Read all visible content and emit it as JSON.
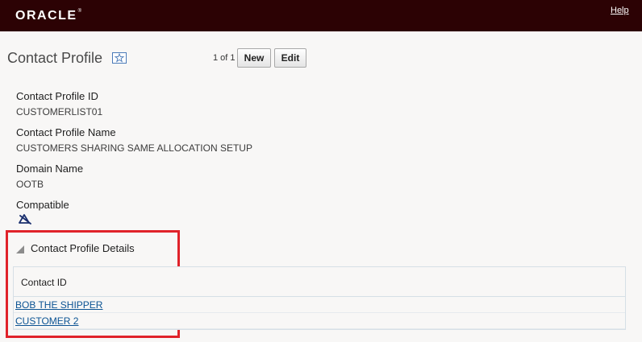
{
  "header": {
    "logo_text": "ORACLE",
    "logo_mark": "®",
    "help_link": "Help",
    "background_color": "#2c0204"
  },
  "page": {
    "title": "Contact Profile",
    "favorite_icon": "star-icon",
    "pager_text": "1 of 1",
    "new_button": "New",
    "edit_button": "Edit"
  },
  "fields": [
    {
      "label": "Contact Profile ID",
      "value": "CUSTOMERLIST01"
    },
    {
      "label": "Contact Profile Name",
      "value": "CUSTOMERS SHARING SAME ALLOCATION SETUP"
    },
    {
      "label": "Domain Name",
      "value": "OOTB"
    },
    {
      "label": "Compatible",
      "icon": "compatible-icon"
    }
  ],
  "details": {
    "section_title": "Contact Profile Details",
    "column_header": "Contact ID",
    "rows": [
      "BOB THE SHIPPER",
      "CUSTOMER 2"
    ],
    "highlight_color": "#e0222a"
  }
}
